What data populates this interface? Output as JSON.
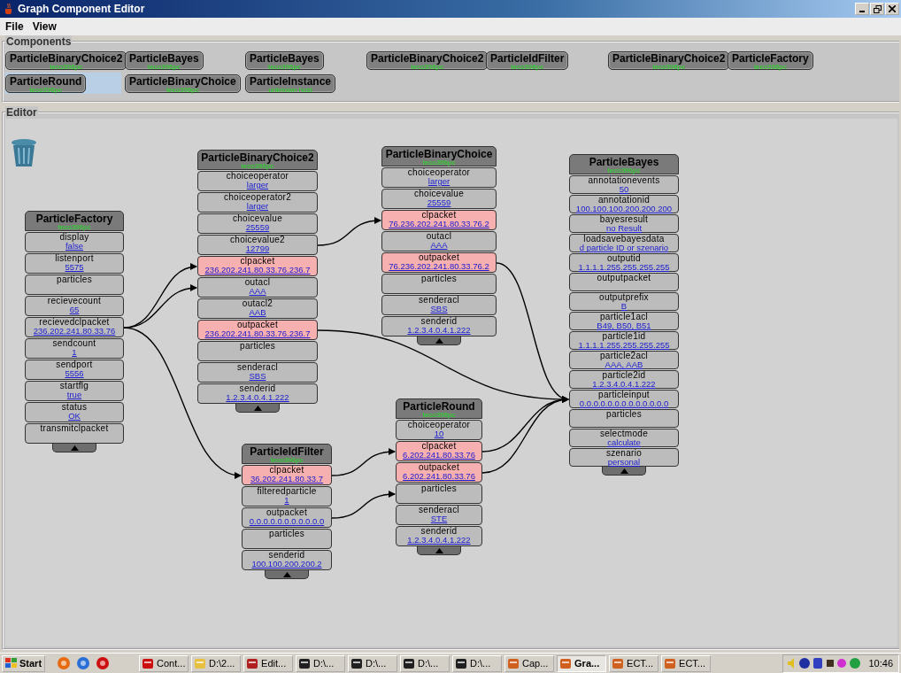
{
  "window": {
    "title": "Graph Component Editor"
  },
  "menu": [
    "File",
    "View"
  ],
  "components": {
    "title": "Components",
    "items": [
      {
        "name": "ParticleBinaryChoice2",
        "host": "teco396pc",
        "selected": false
      },
      {
        "name": "ParticleBayes",
        "host": "teco396pc",
        "selected": false
      },
      {
        "name": "ParticleBayes",
        "host": "teco396pc",
        "selected": false
      },
      {
        "name": "ParticleBinaryChoice2",
        "host": "teco396pc",
        "selected": false
      },
      {
        "name": "ParticleIdFilter",
        "host": "teco396pc",
        "selected": false
      },
      {
        "name": "ParticleBinaryChoice2",
        "host": "teco396pc",
        "selected": false
      },
      {
        "name": "ParticleFactory",
        "host": "teco396pc",
        "selected": false
      },
      {
        "name": "ParticleRound",
        "host": "teco396pc",
        "selected": true
      },
      {
        "name": "ParticleBinaryChoice",
        "host": "teco396pc",
        "selected": false
      },
      {
        "name": "ParticleInstance",
        "host": "unknown host",
        "selected": false
      }
    ]
  },
  "editor": {
    "title": "Editor",
    "nodes": [
      {
        "title": "ParticleFactory",
        "host": "teco396pc",
        "ports": [
          {
            "name": "display",
            "value": "false",
            "highlighted": false
          },
          {
            "name": "listenport",
            "value": "5575",
            "highlighted": false
          },
          {
            "name": "particles",
            "highlighted": false
          },
          {
            "name": "recievecount",
            "value": "65",
            "highlighted": false
          },
          {
            "name": "recievedclpacket",
            "value": "236.202.241.80.33.76",
            "highlighted": false
          },
          {
            "name": "sendcount",
            "value": "1",
            "highlighted": false
          },
          {
            "name": "sendport",
            "value": "5556",
            "highlighted": false
          },
          {
            "name": "startflg",
            "value": "true",
            "highlighted": false
          },
          {
            "name": "status",
            "value": "OK",
            "highlighted": false
          },
          {
            "name": "transmitclpacket",
            "highlighted": false
          }
        ]
      },
      {
        "title": "ParticleBinaryChoice2",
        "host": "teco396pc",
        "ports": [
          {
            "name": "choiceoperator",
            "value": "larger",
            "highlighted": false
          },
          {
            "name": "choiceoperator2",
            "value": "larger",
            "highlighted": false
          },
          {
            "name": "choicevalue",
            "value": "25559",
            "highlighted": false
          },
          {
            "name": "choicevalue2",
            "value": "12799",
            "highlighted": false
          },
          {
            "name": "clpacket",
            "value": "236.202.241.80.33.76.236.7",
            "highlighted": true
          },
          {
            "name": "outacl",
            "value": "AAA",
            "highlighted": false
          },
          {
            "name": "outacl2",
            "value": "AAB",
            "highlighted": false
          },
          {
            "name": "outpacket",
            "value": "236.202.241.80.33.76.236.7",
            "highlighted": true
          },
          {
            "name": "particles",
            "highlighted": false
          },
          {
            "name": "senderacl",
            "value": "SBS",
            "highlighted": false
          },
          {
            "name": "senderid",
            "value": "1.2.3.4.0.4.1.222",
            "highlighted": false
          }
        ]
      },
      {
        "title": "ParticleBinaryChoice",
        "host": "teco396pc",
        "ports": [
          {
            "name": "choiceoperator",
            "value": "larger",
            "highlighted": false
          },
          {
            "name": "choicevalue",
            "value": "25559",
            "highlighted": false
          },
          {
            "name": "clpacket",
            "value": "76.236.202.241.80.33.76.2",
            "highlighted": true
          },
          {
            "name": "outacl",
            "value": "AAA",
            "highlighted": false
          },
          {
            "name": "outpacket",
            "value": "76.236.202.241.80.33.76.2",
            "highlighted": true
          },
          {
            "name": "particles",
            "highlighted": false
          },
          {
            "name": "senderacl",
            "value": "SBS",
            "highlighted": false
          },
          {
            "name": "senderid",
            "value": "1.2.3.4.0.4.1.222",
            "highlighted": false
          }
        ]
      },
      {
        "title": "ParticleBayes",
        "host": "teco396pc",
        "ports": [
          {
            "name": "annotationevents",
            "value": "50",
            "highlighted": false
          },
          {
            "name": "annotationid",
            "value": "100.100.100.200.200.200",
            "highlighted": false
          },
          {
            "name": "bayesresult",
            "value": "no Result",
            "highlighted": false
          },
          {
            "name": "loadsavebayesdata",
            "value": "d particle ID or szenario",
            "highlighted": false
          },
          {
            "name": "outputid",
            "value": "1.1.1.1.255.255.255.255",
            "highlighted": false
          },
          {
            "name": "outputpacket",
            "highlighted": false
          },
          {
            "name": "outputprefix",
            "value": "B",
            "highlighted": false
          },
          {
            "name": "particle1acl",
            "value": "B49, B50, B51",
            "highlighted": false
          },
          {
            "name": "particle1id",
            "value": "1.1.1.1.255.255.255.255",
            "highlighted": false
          },
          {
            "name": "particle2acl",
            "value": "AAA, AAB",
            "highlighted": false
          },
          {
            "name": "particle2id",
            "value": "1.2.3.4.0.4.1.222",
            "highlighted": false
          },
          {
            "name": "particleinput",
            "value": "0.0.0.0.0.0.0.0.0.0.0.0.0",
            "highlighted": false
          },
          {
            "name": "particles",
            "highlighted": false
          },
          {
            "name": "selectmode",
            "value": "calculate",
            "highlighted": false
          },
          {
            "name": "szenario",
            "value": "personal",
            "highlighted": false
          }
        ]
      },
      {
        "title": "ParticleIdFilter",
        "host": "teco396pc",
        "ports": [
          {
            "name": "clpacket",
            "value": "36.202.241.80.33.7",
            "highlighted": true
          },
          {
            "name": "filteredparticle",
            "value": "1",
            "highlighted": false
          },
          {
            "name": "outpacket",
            "value": "0.0.0.0.0.0.0.0.0.0.0",
            "highlighted": false
          },
          {
            "name": "particles",
            "highlighted": false
          },
          {
            "name": "senderid",
            "value": "100.100.200.200.2",
            "highlighted": false
          }
        ]
      },
      {
        "title": "ParticleRound",
        "host": "teco396pc",
        "ports": [
          {
            "name": "choiceoperator",
            "value": "10",
            "highlighted": false
          },
          {
            "name": "clpacket",
            "value": "6.202.241.80.33.76",
            "highlighted": true
          },
          {
            "name": "outpacket",
            "value": "6.202.241.80.33.76",
            "highlighted": true
          },
          {
            "name": "particles",
            "highlighted": false
          },
          {
            "name": "senderacl",
            "value": "STE",
            "highlighted": false
          },
          {
            "name": "senderid",
            "value": "1.2.3.4.0.4.1.222",
            "highlighted": false
          }
        ]
      }
    ],
    "connections_shown": true
  },
  "taskbar": {
    "start": "Start",
    "quick_launch": [
      {
        "kind": "fox"
      },
      {
        "kind": "ie"
      },
      {
        "kind": "opera"
      }
    ],
    "tasks": [
      {
        "label": "Cont...",
        "kind": "opera",
        "selected": false
      },
      {
        "label": "D:\\2...",
        "kind": "folder",
        "selected": false
      },
      {
        "label": "Edit...",
        "kind": "doc",
        "selected": false
      },
      {
        "label": "D:\\...",
        "kind": "console",
        "selected": false
      },
      {
        "label": "D:\\...",
        "kind": "console",
        "selected": false
      },
      {
        "label": "D:\\...",
        "kind": "console",
        "selected": false
      },
      {
        "label": "D:\\...",
        "kind": "console",
        "selected": false
      },
      {
        "label": "Cap...",
        "kind": "java",
        "selected": false
      },
      {
        "label": "Gra...",
        "kind": "java",
        "selected": true
      },
      {
        "label": "ECT...",
        "kind": "java",
        "selected": false
      },
      {
        "label": "ECT...",
        "kind": "java",
        "selected": false
      }
    ],
    "clock": "10:46"
  }
}
